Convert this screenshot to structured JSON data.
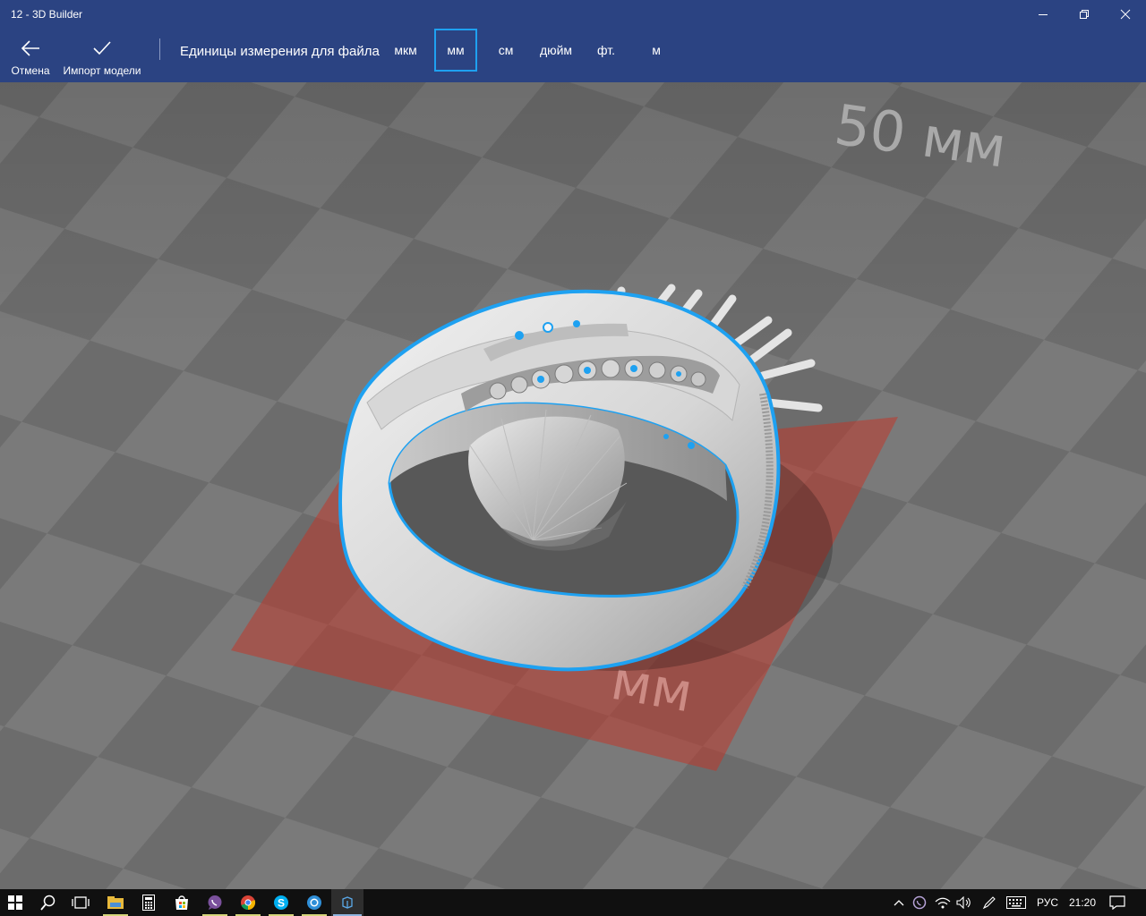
{
  "window": {
    "title": "12 - 3D Builder"
  },
  "toolbar": {
    "cancel_label": "Отмена",
    "import_label": "Импорт модели",
    "units_label": "Единицы измерения для файла",
    "units": [
      "мкм",
      "мм",
      "см",
      "дюйм",
      "фт.",
      "м"
    ],
    "selected_unit": "мм"
  },
  "viewport": {
    "scale_label_top": "50 мм",
    "scale_label_bottom": "мм",
    "selection_color": "#1ea1f1",
    "footprint_color": "#c0392b"
  },
  "taskbar": {
    "apps": [
      "start-icon",
      "search-icon",
      "task-view-icon",
      "file-explorer-icon",
      "calculator-icon",
      "store-icon",
      "viber-icon",
      "chrome-icon",
      "skype-icon",
      "browser-icon",
      "3d-builder-icon"
    ],
    "tray": {
      "language": "РУС",
      "time": "21:20"
    }
  },
  "colors": {
    "accent": "#2b4382",
    "highlight": "#1ea1f1"
  }
}
